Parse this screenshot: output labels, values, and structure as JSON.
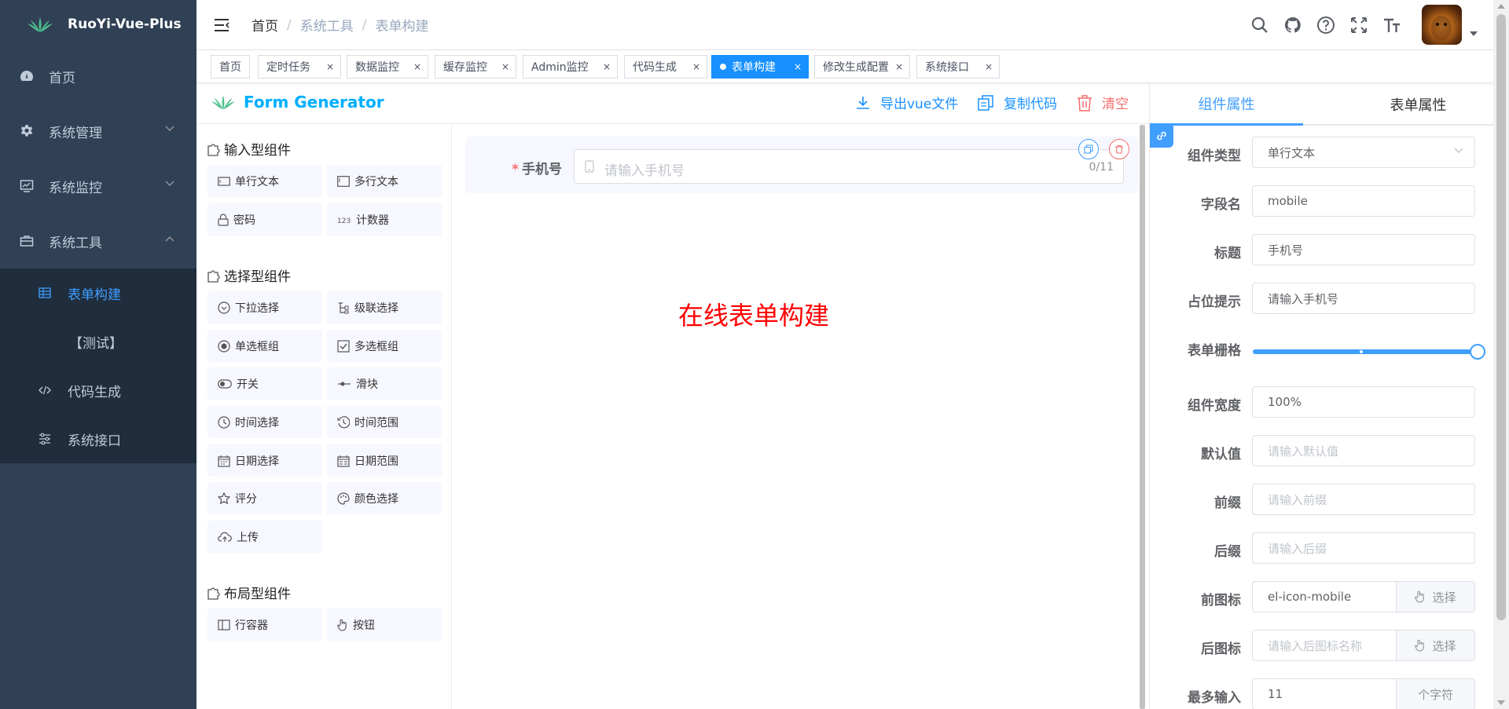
{
  "app": {
    "name": "RuoYi-Vue-Plus"
  },
  "sidebar": {
    "items": [
      {
        "label": "首页",
        "icon": "dashboard-icon"
      },
      {
        "label": "系统管理",
        "icon": "gear-icon"
      },
      {
        "label": "系统监控",
        "icon": "monitor-icon"
      },
      {
        "label": "系统工具",
        "icon": "toolbox-icon",
        "expanded": true
      }
    ],
    "subitems": [
      {
        "label": "表单构建",
        "icon": "form-icon",
        "active": true
      },
      {
        "label": "【测试】",
        "icon": ""
      },
      {
        "label": "代码生成",
        "icon": "code-icon"
      },
      {
        "label": "系统接口",
        "icon": "sliders-icon"
      }
    ]
  },
  "breadcrumb": [
    "首页",
    "系统工具",
    "表单构建"
  ],
  "breadcrumb_separator": "/",
  "tags": [
    {
      "label": "首页",
      "closable": false
    },
    {
      "label": "定时任务",
      "closable": true
    },
    {
      "label": "数据监控",
      "closable": true
    },
    {
      "label": "缓存监控",
      "closable": true
    },
    {
      "label": "Admin监控",
      "closable": true
    },
    {
      "label": "代码生成",
      "closable": true
    },
    {
      "label": "表单构建",
      "closable": true,
      "active": true
    },
    {
      "label": "修改生成配置",
      "closable": true
    },
    {
      "label": "系统接口",
      "closable": true
    }
  ],
  "tag_close_glyph": "×",
  "generator": {
    "title": "Form Generator",
    "actions": {
      "export": "导出vue文件",
      "copy": "复制代码",
      "clear": "清空"
    }
  },
  "components": {
    "input_title": "输入型组件",
    "input": [
      "单行文本",
      "多行文本",
      "密码",
      "计数器"
    ],
    "select_title": "选择型组件",
    "select": [
      "下拉选择",
      "级联选择",
      "单选框组",
      "多选框组",
      "开关",
      "滑块",
      "时间选择",
      "时间范围",
      "日期选择",
      "日期范围",
      "评分",
      "颜色选择",
      "上传"
    ],
    "layout_title": "布局型组件",
    "layout": [
      "行容器",
      "按钮"
    ]
  },
  "canvas": {
    "field_label": "手机号",
    "required_mark": "*",
    "placeholder": "请输入手机号",
    "counter": "0/11",
    "empty_info": "在线表单构建"
  },
  "props": {
    "tabs": [
      "组件属性",
      "表单属性"
    ],
    "fields": [
      {
        "label": "组件类型",
        "value": "单行文本",
        "type": "select"
      },
      {
        "label": "字段名",
        "value": "mobile"
      },
      {
        "label": "标题",
        "value": "手机号"
      },
      {
        "label": "占位提示",
        "value": "请输入手机号"
      },
      {
        "label": "表单栅格",
        "type": "slider",
        "value": 24,
        "max": 24
      },
      {
        "label": "组件宽度",
        "value": "100%"
      },
      {
        "label": "默认值",
        "placeholder": "请输入默认值"
      },
      {
        "label": "前缀",
        "placeholder": "请输入前缀"
      },
      {
        "label": "后缀",
        "placeholder": "请输入后缀"
      },
      {
        "label": "前图标",
        "value": "el-icon-mobile",
        "append": "选择"
      },
      {
        "label": "后图标",
        "placeholder": "请输入后图标名称",
        "append": "选择"
      },
      {
        "label": "最多输入",
        "value": "11",
        "append": "个字符"
      }
    ]
  },
  "colors": {
    "primary": "#409eff",
    "sidebar_bg": "#304156",
    "danger": "#f56c6c",
    "tag_active": "#1890ff"
  }
}
